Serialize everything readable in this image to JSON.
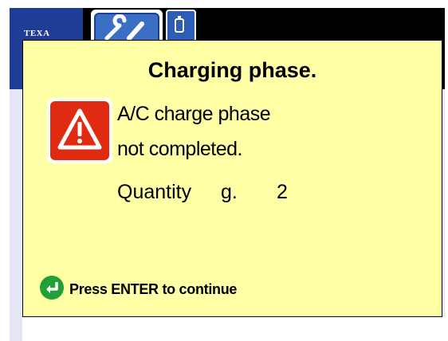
{
  "app": {
    "logo_text": "TEXA",
    "toolbar_icons": [
      "tools-icon",
      "device-icon"
    ]
  },
  "dialog": {
    "title": "Charging phase.",
    "icon": "warning-icon",
    "message_line_1": "A/C charge phase",
    "message_line_2": "not completed.",
    "quantity_label": "Quantity",
    "quantity_unit": "g.",
    "quantity_value": "2",
    "enter_icon": "enter-icon",
    "enter_prompt": "Press ENTER to continue"
  },
  "colors": {
    "dialog_background": "#ffffa6",
    "warning_red": "#e02a12",
    "enter_green": "#22a036",
    "brand_blue": "#1f3d94"
  }
}
